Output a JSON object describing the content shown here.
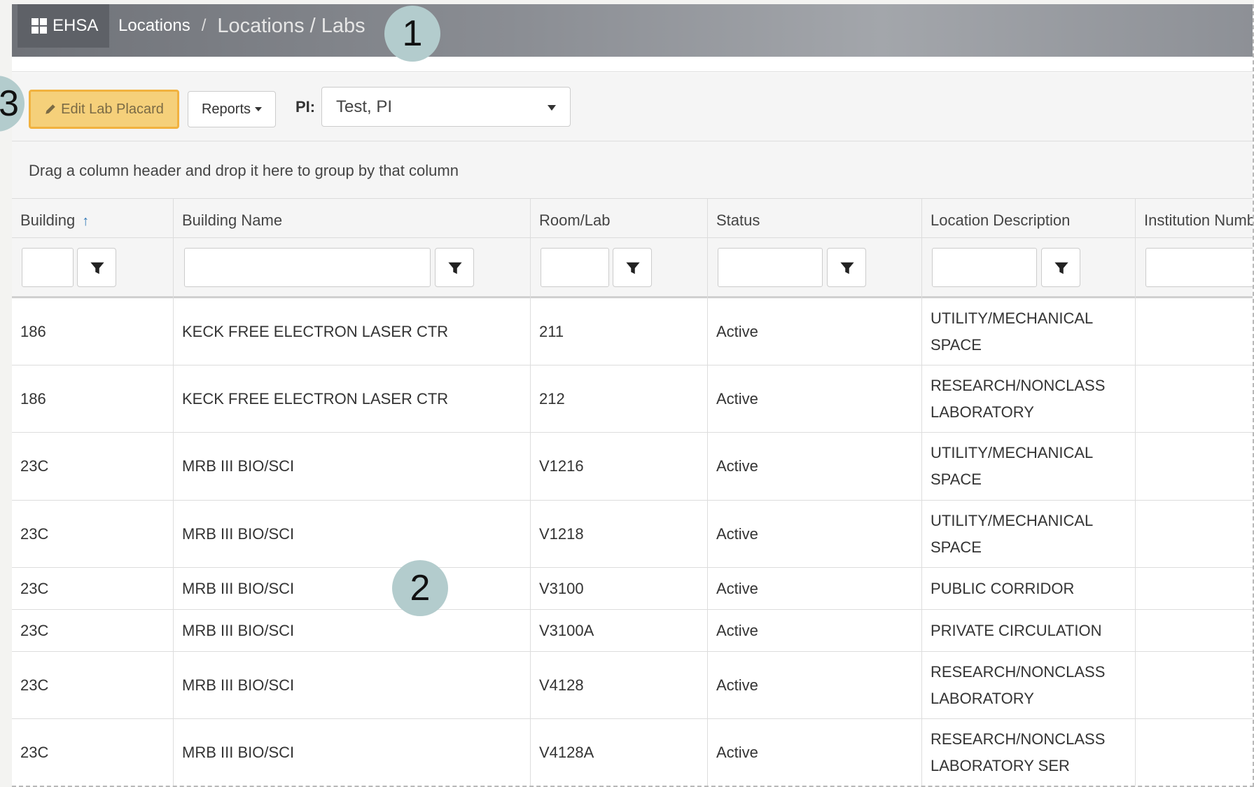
{
  "header": {
    "app_name": "EHSA",
    "breadcrumb_link": "Locations",
    "breadcrumb_sep": "/",
    "breadcrumb_current": "Locations / Labs"
  },
  "toolbar": {
    "edit_label": "Edit Lab Placard",
    "reports_label": "Reports",
    "pi_label": "PI:",
    "pi_value": "Test, PI"
  },
  "grouping_hint": "Drag a column header and drop it here to group by that column",
  "columns": [
    "Building",
    "Building Name",
    "Room/Lab",
    "Status",
    "Location Description",
    "Institution Number"
  ],
  "rows": [
    {
      "building": "186",
      "name": "KECK FREE ELECTRON LASER CTR",
      "room": "211",
      "status": "Active",
      "desc_1": "UTILITY/MECHANICAL",
      "desc_2": "SPACE"
    },
    {
      "building": "186",
      "name": "KECK FREE ELECTRON LASER CTR",
      "room": "212",
      "status": "Active",
      "desc_1": "RESEARCH/NONCLASS",
      "desc_2": "LABORATORY"
    },
    {
      "building": "23C",
      "name": "MRB III BIO/SCI",
      "room": "V1216",
      "status": "Active",
      "desc_1": "UTILITY/MECHANICAL",
      "desc_2": "SPACE"
    },
    {
      "building": "23C",
      "name": "MRB III BIO/SCI",
      "room": "V1218",
      "status": "Active",
      "desc_1": "UTILITY/MECHANICAL",
      "desc_2": "SPACE"
    },
    {
      "building": "23C",
      "name": "MRB III BIO/SCI",
      "room": "V3100",
      "status": "Active",
      "desc_1": "PUBLIC CORRIDOR",
      "desc_2": ""
    },
    {
      "building": "23C",
      "name": "MRB III BIO/SCI",
      "room": "V3100A",
      "status": "Active",
      "desc_1": "PRIVATE CIRCULATION",
      "desc_2": ""
    },
    {
      "building": "23C",
      "name": "MRB III BIO/SCI",
      "room": "V4128",
      "status": "Active",
      "desc_1": "RESEARCH/NONCLASS",
      "desc_2": "LABORATORY"
    },
    {
      "building": "23C",
      "name": "MRB III BIO/SCI",
      "room": "V4128A",
      "status": "Active",
      "desc_1": "RESEARCH/NONCLASS",
      "desc_2": "LABORATORY SER"
    }
  ],
  "callouts": [
    "1",
    "2",
    "3"
  ],
  "icons": {
    "edit": "pencil-icon",
    "filter": "filter-icon",
    "sort": "sort-asc-icon",
    "apps": "grid-icon"
  }
}
